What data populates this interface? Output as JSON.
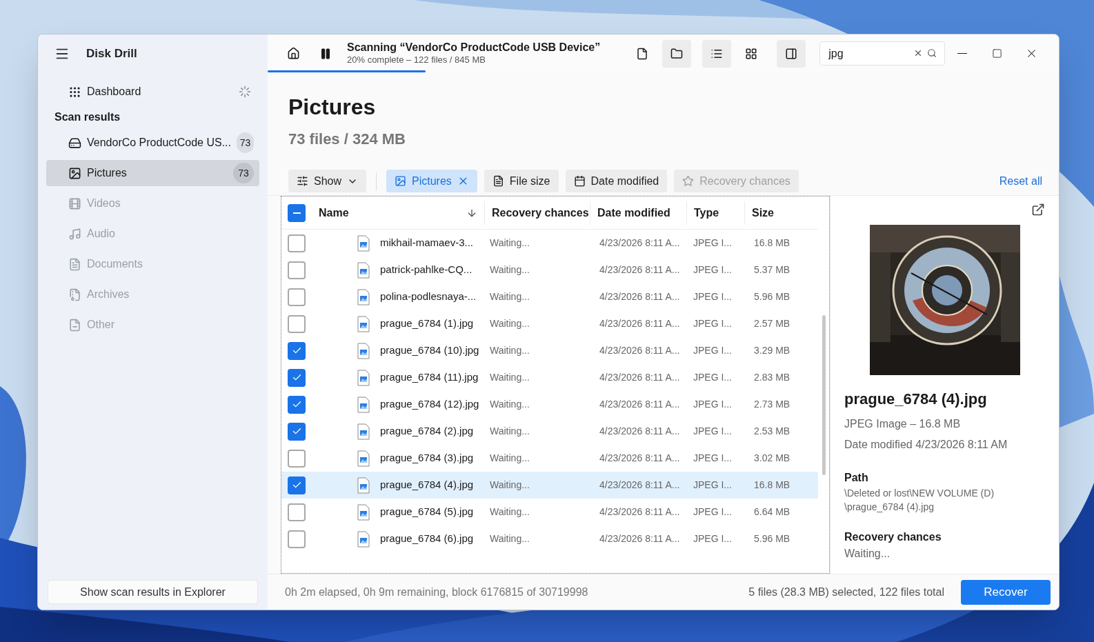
{
  "app": {
    "title": "Disk Drill"
  },
  "sidebar": {
    "dashboard": {
      "label": "Dashboard",
      "busy": true
    },
    "section_heading": "Scan results",
    "items": [
      {
        "label": "VendorCo ProductCode US...",
        "count": "73",
        "selected": false,
        "disabled": false
      },
      {
        "label": "Pictures",
        "count": "73",
        "selected": true,
        "disabled": false
      },
      {
        "label": "Videos",
        "selected": false,
        "disabled": true
      },
      {
        "label": "Audio",
        "selected": false,
        "disabled": true
      },
      {
        "label": "Documents",
        "selected": false,
        "disabled": true
      },
      {
        "label": "Archives",
        "selected": false,
        "disabled": true
      },
      {
        "label": "Other",
        "selected": false,
        "disabled": true
      }
    ],
    "footer_button": "Show scan results in Explorer"
  },
  "scan": {
    "title": "Scanning “VendorCo ProductCode USB Device”",
    "progress": "20% complete – 122 files / 845 MB",
    "level": 0.2
  },
  "toolbar": [
    {
      "selected": false
    },
    {
      "selected": true
    },
    {
      "selected": true
    },
    {
      "selected": false
    },
    {
      "selected": true
    }
  ],
  "search": {
    "value": "jpg"
  },
  "header": {
    "title": "Pictures",
    "subtitle": "73 files / 324 MB"
  },
  "filters": [
    {
      "kind": "dropdown",
      "label": "Show",
      "active": false,
      "disabled": false
    },
    {
      "kind": "chip",
      "label": "Pictures",
      "active": true,
      "disabled": false
    },
    {
      "kind": "chip",
      "label": "File size",
      "active": false,
      "disabled": false
    },
    {
      "kind": "chip",
      "label": "Date modified",
      "active": false,
      "disabled": false
    },
    {
      "kind": "chip",
      "label": "Recovery chances",
      "active": false,
      "disabled": true
    }
  ],
  "reset_link": "Reset all",
  "table": {
    "select_all": {
      "indeterminate": true
    },
    "columns": [
      "Name",
      "Recovery chances",
      "Date modified",
      "Type",
      "Size"
    ],
    "rows": [
      {
        "name": "mikhail-mamaev-3...",
        "recovery": "Waiting...",
        "date": "4/23/2026 8:11 A...",
        "type": "JPEG I...",
        "size": "16.8 MB",
        "checked": false,
        "selected": false
      },
      {
        "name": "patrick-pahlke-CQ...",
        "recovery": "Waiting...",
        "date": "4/23/2026 8:11 A...",
        "type": "JPEG I...",
        "size": "5.37 MB",
        "checked": false,
        "selected": false
      },
      {
        "name": "polina-podlesnaya-...",
        "recovery": "Waiting...",
        "date": "4/23/2026 8:11 A...",
        "type": "JPEG I...",
        "size": "5.96 MB",
        "checked": false,
        "selected": false
      },
      {
        "name": "prague_6784 (1).jpg",
        "recovery": "Waiting...",
        "date": "4/23/2026 8:11 A...",
        "type": "JPEG I...",
        "size": "2.57 MB",
        "checked": false,
        "selected": false
      },
      {
        "name": "prague_6784 (10).jpg",
        "recovery": "Waiting...",
        "date": "4/23/2026 8:11 A...",
        "type": "JPEG I...",
        "size": "3.29 MB",
        "checked": true,
        "selected": false
      },
      {
        "name": "prague_6784 (11).jpg",
        "recovery": "Waiting...",
        "date": "4/23/2026 8:11 A...",
        "type": "JPEG I...",
        "size": "2.83 MB",
        "checked": true,
        "selected": false
      },
      {
        "name": "prague_6784 (12).jpg",
        "recovery": "Waiting...",
        "date": "4/23/2026 8:11 A...",
        "type": "JPEG I...",
        "size": "2.73 MB",
        "checked": true,
        "selected": false
      },
      {
        "name": "prague_6784 (2).jpg",
        "recovery": "Waiting...",
        "date": "4/23/2026 8:11 A...",
        "type": "JPEG I...",
        "size": "2.53 MB",
        "checked": true,
        "selected": false
      },
      {
        "name": "prague_6784 (3).jpg",
        "recovery": "Waiting...",
        "date": "4/23/2026 8:11 A...",
        "type": "JPEG I...",
        "size": "3.02 MB",
        "checked": false,
        "selected": false
      },
      {
        "name": "prague_6784 (4).jpg",
        "recovery": "Waiting...",
        "date": "4/23/2026 8:11 A...",
        "type": "JPEG I...",
        "size": "16.8 MB",
        "checked": true,
        "selected": true
      },
      {
        "name": "prague_6784 (5).jpg",
        "recovery": "Waiting...",
        "date": "4/23/2026 8:11 A...",
        "type": "JPEG I...",
        "size": "6.64 MB",
        "checked": false,
        "selected": false
      },
      {
        "name": "prague_6784 (6).jpg",
        "recovery": "Waiting...",
        "date": "4/23/2026 8:11 A...",
        "type": "JPEG I...",
        "size": "5.96 MB",
        "checked": false,
        "selected": false
      }
    ]
  },
  "preview": {
    "name": "prague_6784 (4).jpg",
    "info": "JPEG Image – 16.8 MB",
    "date": "Date modified 4/23/2026 8:11 AM",
    "path_label": "Path",
    "path_lines": [
      "\\Deleted or lost\\NEW VOLUME (D)",
      "\\prague_6784 (4).jpg"
    ],
    "recovery_label": "Recovery chances",
    "recovery_value": "Waiting..."
  },
  "status": {
    "elapsed": "0h 2m elapsed, 0h 9m remaining, block 6176815 of 30719998",
    "selection": "5 files (28.3 MB) selected, 122 files total",
    "button": "Recover"
  }
}
